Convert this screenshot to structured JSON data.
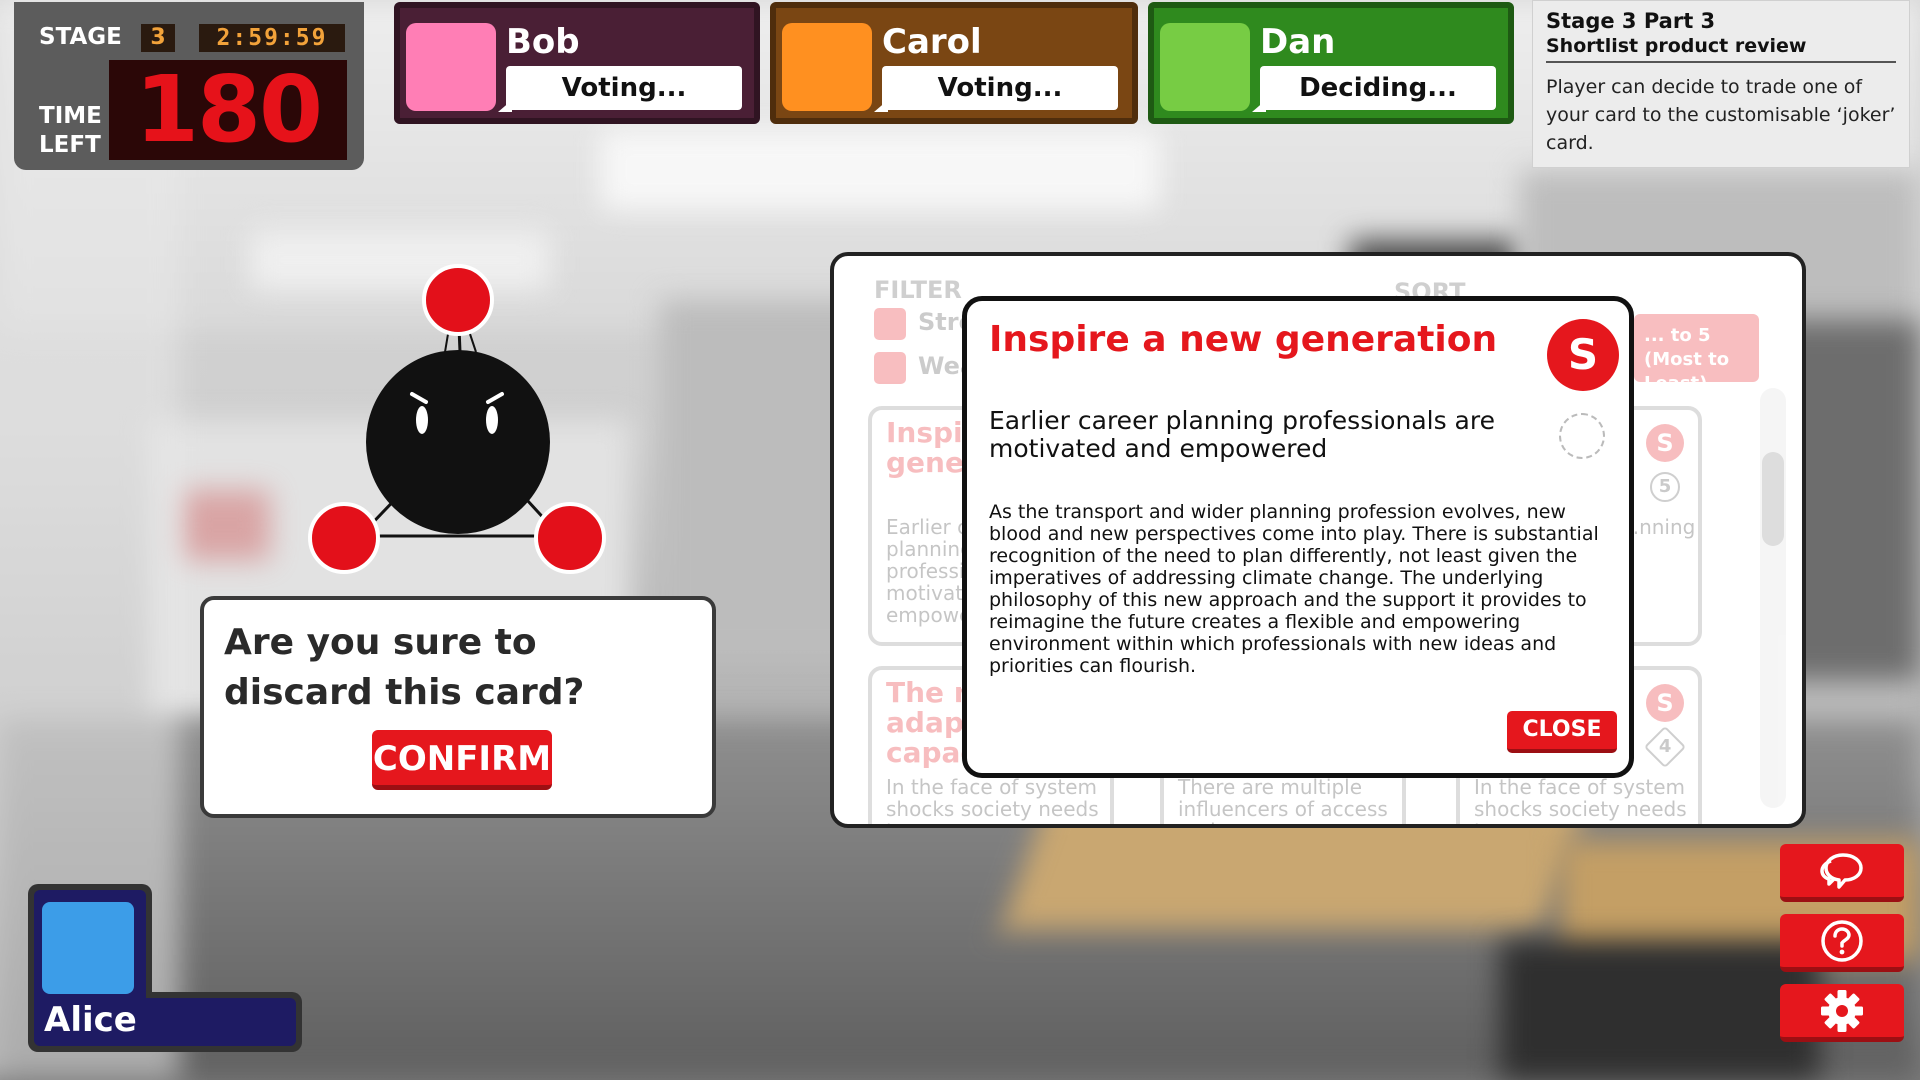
{
  "timer": {
    "stage_label": "STAGE",
    "stage_number": "3",
    "clock": "2:59:59",
    "time_left_label_1": "TIME",
    "time_left_label_2": "LEFT",
    "time_left_value": "180"
  },
  "players": [
    {
      "name": "Bob",
      "status": "Voting...",
      "color": "#ff7eb5",
      "panel": "#4a1f35"
    },
    {
      "name": "Carol",
      "status": "Voting...",
      "color": "#ff9020",
      "panel": "#7a4613"
    },
    {
      "name": "Dan",
      "status": "Deciding...",
      "color": "#77cc44",
      "panel": "#2f8a1e"
    }
  ],
  "stage_info": {
    "title": "Stage 3 Part 3",
    "subtitle": "Shortlist product review",
    "text": "Player can decide to trade one of your card to the customisable ‘joker’ card."
  },
  "discard_prompt": {
    "question": "Are you sure to discard this card?",
    "confirm_label": "CONFIRM"
  },
  "card_browser": {
    "filter_label": "FILTER",
    "sort_label": "SORT",
    "filters": [
      "Strengths",
      "Weaknesses"
    ],
    "sort_button": [
      "... to 5",
      "(Most to Least)"
    ],
    "cards": [
      {
        "title": "Inspire a new generation",
        "body": "Earlier career planning professionals are motivated and empowered",
        "badge": "S",
        "score": "5"
      },
      {
        "title": "The need to adapt capacity",
        "body": "In the face of system shocks society needs to",
        "badge": "S",
        "score": "4"
      }
    ],
    "partial_texts": [
      "...nning",
      "There are multiple influencers of access and",
      "In the face of system shocks society needs to"
    ]
  },
  "card_modal": {
    "title": "Inspire a new generation",
    "badge": "S",
    "subtitle": "Earlier career planning professionals are motivated and empowered",
    "body": "As the transport and wider planning profession evolves, new blood and new perspectives come into play. There is substantial recognition of the need to plan differently, not least given the imperatives of addressing climate change. The underlying philosophy of this new approach and the support it provides to reimagine the future creates a flexible and empowering environment within which professionals with new ideas and priorities can flourish.",
    "close_label": "CLOSE"
  },
  "local_player": {
    "name": "Alice",
    "color": "#3c9de8"
  },
  "actions": [
    {
      "name": "chat-icon"
    },
    {
      "name": "help-icon"
    },
    {
      "name": "settings-icon"
    }
  ],
  "accent_color": "#e5171d"
}
